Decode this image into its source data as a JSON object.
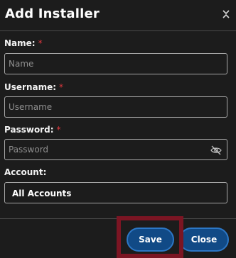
{
  "dialog": {
    "title": "Add Installer",
    "close_icon": "collapse-icon"
  },
  "form": {
    "name": {
      "label": "Name:",
      "required_mark": "*",
      "placeholder": "Name",
      "value": ""
    },
    "username": {
      "label": "Username:",
      "required_mark": "*",
      "placeholder": "Username",
      "value": ""
    },
    "password": {
      "label": "Password:",
      "required_mark": "*",
      "placeholder": "Password",
      "value": "",
      "toggle_icon": "eye-slash-icon"
    },
    "account": {
      "label": "Account:",
      "selected": "All Accounts"
    }
  },
  "footer": {
    "save_label": "Save",
    "close_label": "Close"
  },
  "colors": {
    "background": "#1c1c1c",
    "required": "#e0383e",
    "button_fill": "#114a86",
    "button_border": "#2c77c6",
    "highlight": "#7b1523"
  }
}
